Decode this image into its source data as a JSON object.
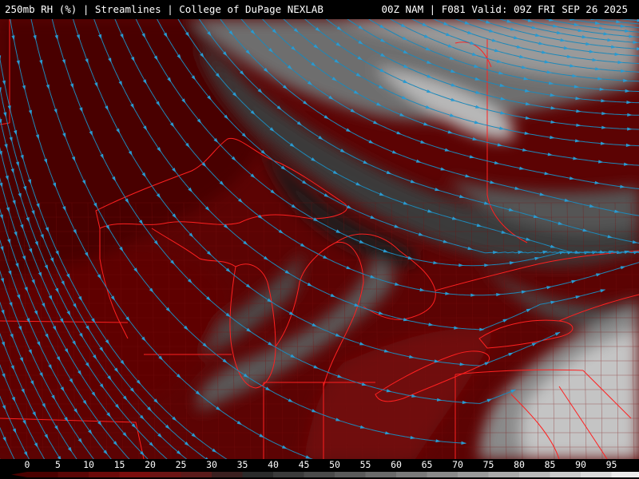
{
  "header": {
    "left_title": "250mb RH (%) | Streamlines | College of DuPage NEXLAB",
    "right_title": "00Z NAM | F081 Valid: 09Z FRI SEP 26 2025"
  },
  "colorbar": {
    "ticks": [
      "0",
      "5",
      "10",
      "15",
      "20",
      "25",
      "30",
      "35",
      "40",
      "45",
      "50",
      "55",
      "60",
      "65",
      "70",
      "75",
      "80",
      "85",
      "90",
      "95"
    ],
    "colors": [
      "#4a0000",
      "#5a0606",
      "#6b0a0a",
      "#7a0d0d",
      "#6c1414",
      "#5a1a1a",
      "#3a1f1f",
      "#2a2a2a",
      "#3a3a3a",
      "#4a4a4a",
      "#5a5a5a",
      "#6a6a6a",
      "#7a7a7a",
      "#8a8a8a",
      "#9a9a9a",
      "#aaaaaa",
      "#bababa",
      "#cacaca",
      "#dadada",
      "#ebebeb"
    ]
  },
  "map_colors": {
    "borders": "#ff2020",
    "streamlines": "#1e88b8",
    "dry": "#5a0000",
    "moist": "#c8c8c8"
  }
}
